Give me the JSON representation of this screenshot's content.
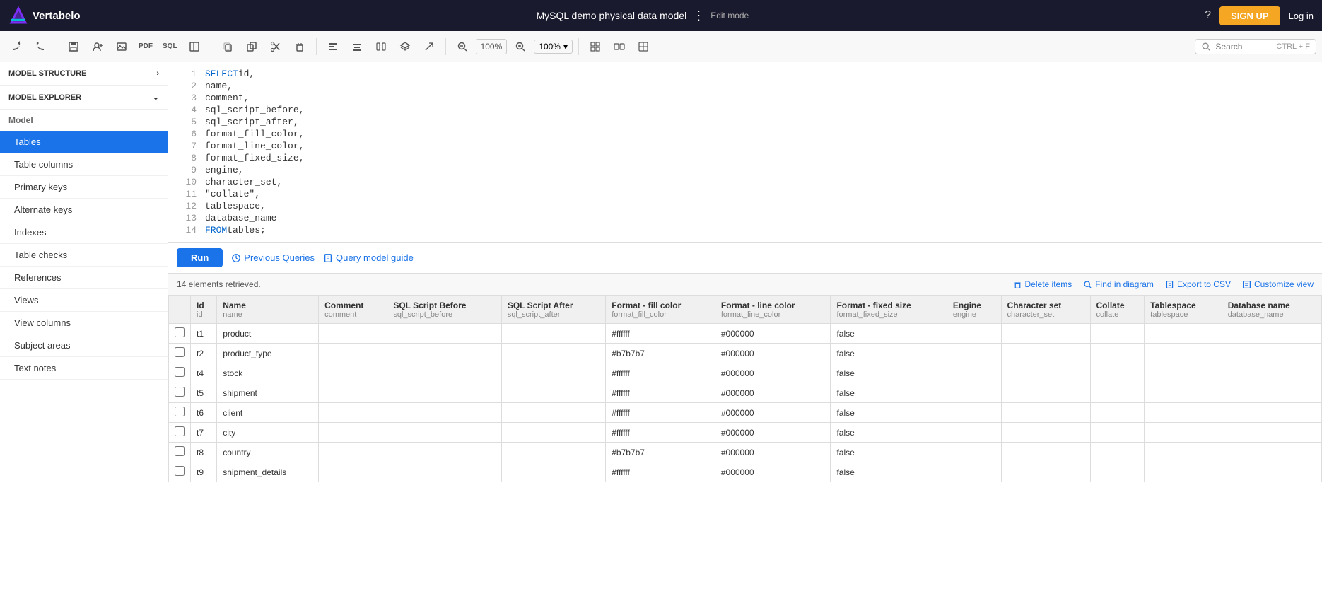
{
  "app": {
    "title": "MySQL demo physical data model",
    "mode": "Edit mode",
    "logo_text": "Vertabelo"
  },
  "nav": {
    "help_label": "?",
    "signup_label": "SIGN UP",
    "login_label": "Log in",
    "search_placeholder": "Search",
    "search_shortcut": "CTRL + F"
  },
  "toolbar": {
    "undo_label": "↩",
    "redo_label": "↪",
    "zoom_in_label": "+",
    "zoom_out_label": "−",
    "zoom_level": "100%",
    "zoom_reset_label": "100%"
  },
  "sidebar": {
    "model_structure_label": "MODEL STRUCTURE",
    "model_explorer_label": "MODEL EXPLORER",
    "model_label": "Model",
    "items": [
      {
        "id": "tables",
        "label": "Tables",
        "active": true
      },
      {
        "id": "table-columns",
        "label": "Table columns",
        "active": false
      },
      {
        "id": "primary-keys",
        "label": "Primary keys",
        "active": false
      },
      {
        "id": "alternate-keys",
        "label": "Alternate keys",
        "active": false
      },
      {
        "id": "indexes",
        "label": "Indexes",
        "active": false
      },
      {
        "id": "table-checks",
        "label": "Table checks",
        "active": false
      },
      {
        "id": "references",
        "label": "References",
        "active": false
      },
      {
        "id": "views",
        "label": "Views",
        "active": false
      },
      {
        "id": "view-columns",
        "label": "View columns",
        "active": false
      },
      {
        "id": "subject-areas",
        "label": "Subject areas",
        "active": false
      },
      {
        "id": "text-notes",
        "label": "Text notes",
        "active": false
      }
    ]
  },
  "editor": {
    "lines": [
      {
        "num": 1,
        "keyword": "SELECT",
        "rest": " id,"
      },
      {
        "num": 2,
        "keyword": "",
        "rest": "  name,"
      },
      {
        "num": 3,
        "keyword": "",
        "rest": "  comment,"
      },
      {
        "num": 4,
        "keyword": "",
        "rest": "  sql_script_before,"
      },
      {
        "num": 5,
        "keyword": "",
        "rest": "  sql_script_after,"
      },
      {
        "num": 6,
        "keyword": "",
        "rest": "  format_fill_color,"
      },
      {
        "num": 7,
        "keyword": "",
        "rest": "  format_line_color,"
      },
      {
        "num": 8,
        "keyword": "",
        "rest": "  format_fixed_size,"
      },
      {
        "num": 9,
        "keyword": "",
        "rest": "  engine,"
      },
      {
        "num": 10,
        "keyword": "",
        "rest": "  character_set,"
      },
      {
        "num": 11,
        "keyword": "",
        "rest": "  \"collate\","
      },
      {
        "num": 12,
        "keyword": "",
        "rest": "  tablespace,"
      },
      {
        "num": 13,
        "keyword": "",
        "rest": "  database_name"
      },
      {
        "num": 14,
        "keyword": "FROM",
        "rest": " tables;"
      }
    ]
  },
  "actions": {
    "run_label": "Run",
    "prev_queries_label": "Previous Queries",
    "query_guide_label": "Query model guide"
  },
  "results": {
    "summary": "14 elements retrieved.",
    "delete_items_label": "Delete items",
    "find_in_diagram_label": "Find in diagram",
    "export_csv_label": "Export to CSV",
    "customize_label": "Customize view",
    "columns": [
      {
        "header": "Id",
        "sub": "id"
      },
      {
        "header": "Name",
        "sub": "name"
      },
      {
        "header": "Comment",
        "sub": "comment"
      },
      {
        "header": "SQL Script Before",
        "sub": "sql_script_before"
      },
      {
        "header": "SQL Script After",
        "sub": "sql_script_after"
      },
      {
        "header": "Format - fill color",
        "sub": "format_fill_color"
      },
      {
        "header": "Format - line color",
        "sub": "format_line_color"
      },
      {
        "header": "Format - fixed size",
        "sub": "format_fixed_size"
      },
      {
        "header": "Engine",
        "sub": "engine"
      },
      {
        "header": "Character set",
        "sub": "character_set"
      },
      {
        "header": "Collate",
        "sub": "collate"
      },
      {
        "header": "Tablespace",
        "sub": "tablespace"
      },
      {
        "header": "Database name",
        "sub": "database_name"
      }
    ],
    "rows": [
      {
        "id": "t1",
        "name": "product",
        "comment": "",
        "sql_before": "",
        "sql_after": "",
        "fill_color": "#ffffff",
        "line_color": "#000000",
        "fixed_size": "false",
        "engine": "",
        "char_set": "",
        "collate": "",
        "tablespace": "",
        "db_name": ""
      },
      {
        "id": "t2",
        "name": "product_type",
        "comment": "",
        "sql_before": "",
        "sql_after": "",
        "fill_color": "#b7b7b7",
        "line_color": "#000000",
        "fixed_size": "false",
        "engine": "",
        "char_set": "",
        "collate": "",
        "tablespace": "",
        "db_name": ""
      },
      {
        "id": "t4",
        "name": "stock",
        "comment": "",
        "sql_before": "",
        "sql_after": "",
        "fill_color": "#ffffff",
        "line_color": "#000000",
        "fixed_size": "false",
        "engine": "",
        "char_set": "",
        "collate": "",
        "tablespace": "",
        "db_name": ""
      },
      {
        "id": "t5",
        "name": "shipment",
        "comment": "",
        "sql_before": "",
        "sql_after": "",
        "fill_color": "#ffffff",
        "line_color": "#000000",
        "fixed_size": "false",
        "engine": "",
        "char_set": "",
        "collate": "",
        "tablespace": "",
        "db_name": ""
      },
      {
        "id": "t6",
        "name": "client",
        "comment": "",
        "sql_before": "",
        "sql_after": "",
        "fill_color": "#ffffff",
        "line_color": "#000000",
        "fixed_size": "false",
        "engine": "",
        "char_set": "",
        "collate": "",
        "tablespace": "",
        "db_name": ""
      },
      {
        "id": "t7",
        "name": "city",
        "comment": "",
        "sql_before": "",
        "sql_after": "",
        "fill_color": "#ffffff",
        "line_color": "#000000",
        "fixed_size": "false",
        "engine": "",
        "char_set": "",
        "collate": "",
        "tablespace": "",
        "db_name": ""
      },
      {
        "id": "t8",
        "name": "country",
        "comment": "",
        "sql_before": "",
        "sql_after": "",
        "fill_color": "#b7b7b7",
        "line_color": "#000000",
        "fixed_size": "false",
        "engine": "",
        "char_set": "",
        "collate": "",
        "tablespace": "",
        "db_name": ""
      },
      {
        "id": "t9",
        "name": "shipment_details",
        "comment": "",
        "sql_before": "",
        "sql_after": "",
        "fill_color": "#ffffff",
        "line_color": "#000000",
        "fixed_size": "false",
        "engine": "",
        "char_set": "",
        "collate": "",
        "tablespace": "",
        "db_name": ""
      }
    ]
  }
}
